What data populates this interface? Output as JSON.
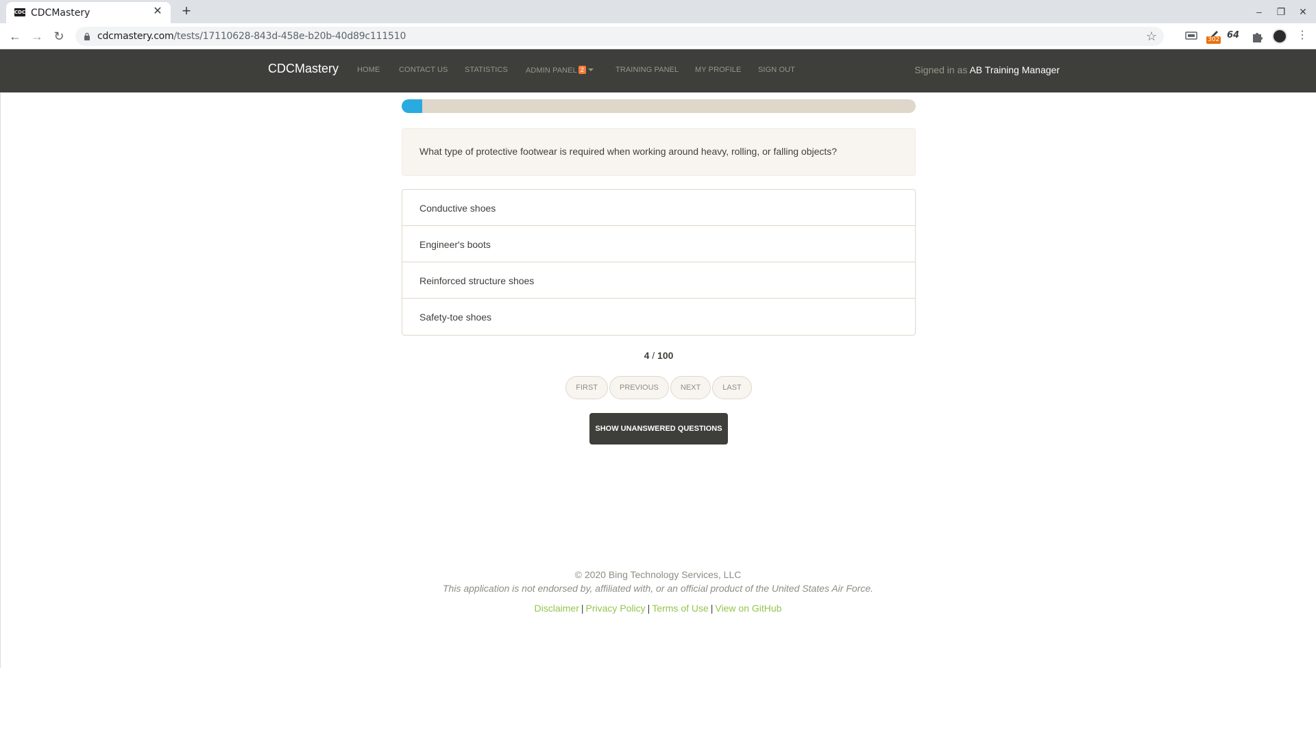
{
  "browser": {
    "tab_title": "CDCMastery",
    "favicon_text": "CDC",
    "url_host": "cdcmastery.com",
    "url_path": "/tests/17110628-843d-458e-b20b-40d89c111510",
    "extension_badge": "302",
    "extension_count": "64"
  },
  "navbar": {
    "brand": "CDCMastery",
    "links": [
      {
        "label": "HOME"
      },
      {
        "label": "CONTACT US"
      },
      {
        "label": "STATISTICS"
      },
      {
        "label": "ADMIN PANEL",
        "badge": "2"
      },
      {
        "label": "TRAINING PANEL"
      },
      {
        "label": "MY PROFILE"
      },
      {
        "label": "SIGN OUT"
      }
    ],
    "signed_in_prefix": "Signed in as",
    "user_name": "AB Training Manager"
  },
  "test": {
    "progress_fraction": 0.04,
    "question": "What type of protective footwear is required when working around heavy, rolling, or falling objects?",
    "answers": [
      "Conductive shoes",
      "Engineer's boots",
      "Reinforced structure shoes",
      "Safety-toe shoes"
    ],
    "current": "4",
    "total": "100",
    "pager": {
      "first": "FIRST",
      "previous": "PREVIOUS",
      "next": "NEXT",
      "last": "LAST"
    },
    "show_unanswered": "SHOW UNANSWERED QUESTIONS"
  },
  "footer": {
    "copyright": "© 2020 Bing Technology Services, LLC",
    "disclaimer": "This application is not endorsed by, affiliated with, or an official product of the United States Air Force.",
    "links": [
      "Disclaimer",
      "Privacy Policy",
      "Terms of Use",
      "View on GitHub"
    ]
  },
  "colors": {
    "navbar_bg": "#3e3f3a",
    "progress_fill": "#29abe0",
    "progress_track": "#dfd7ca",
    "link_green": "#93c54b",
    "badge_orange": "#f47c3c"
  }
}
